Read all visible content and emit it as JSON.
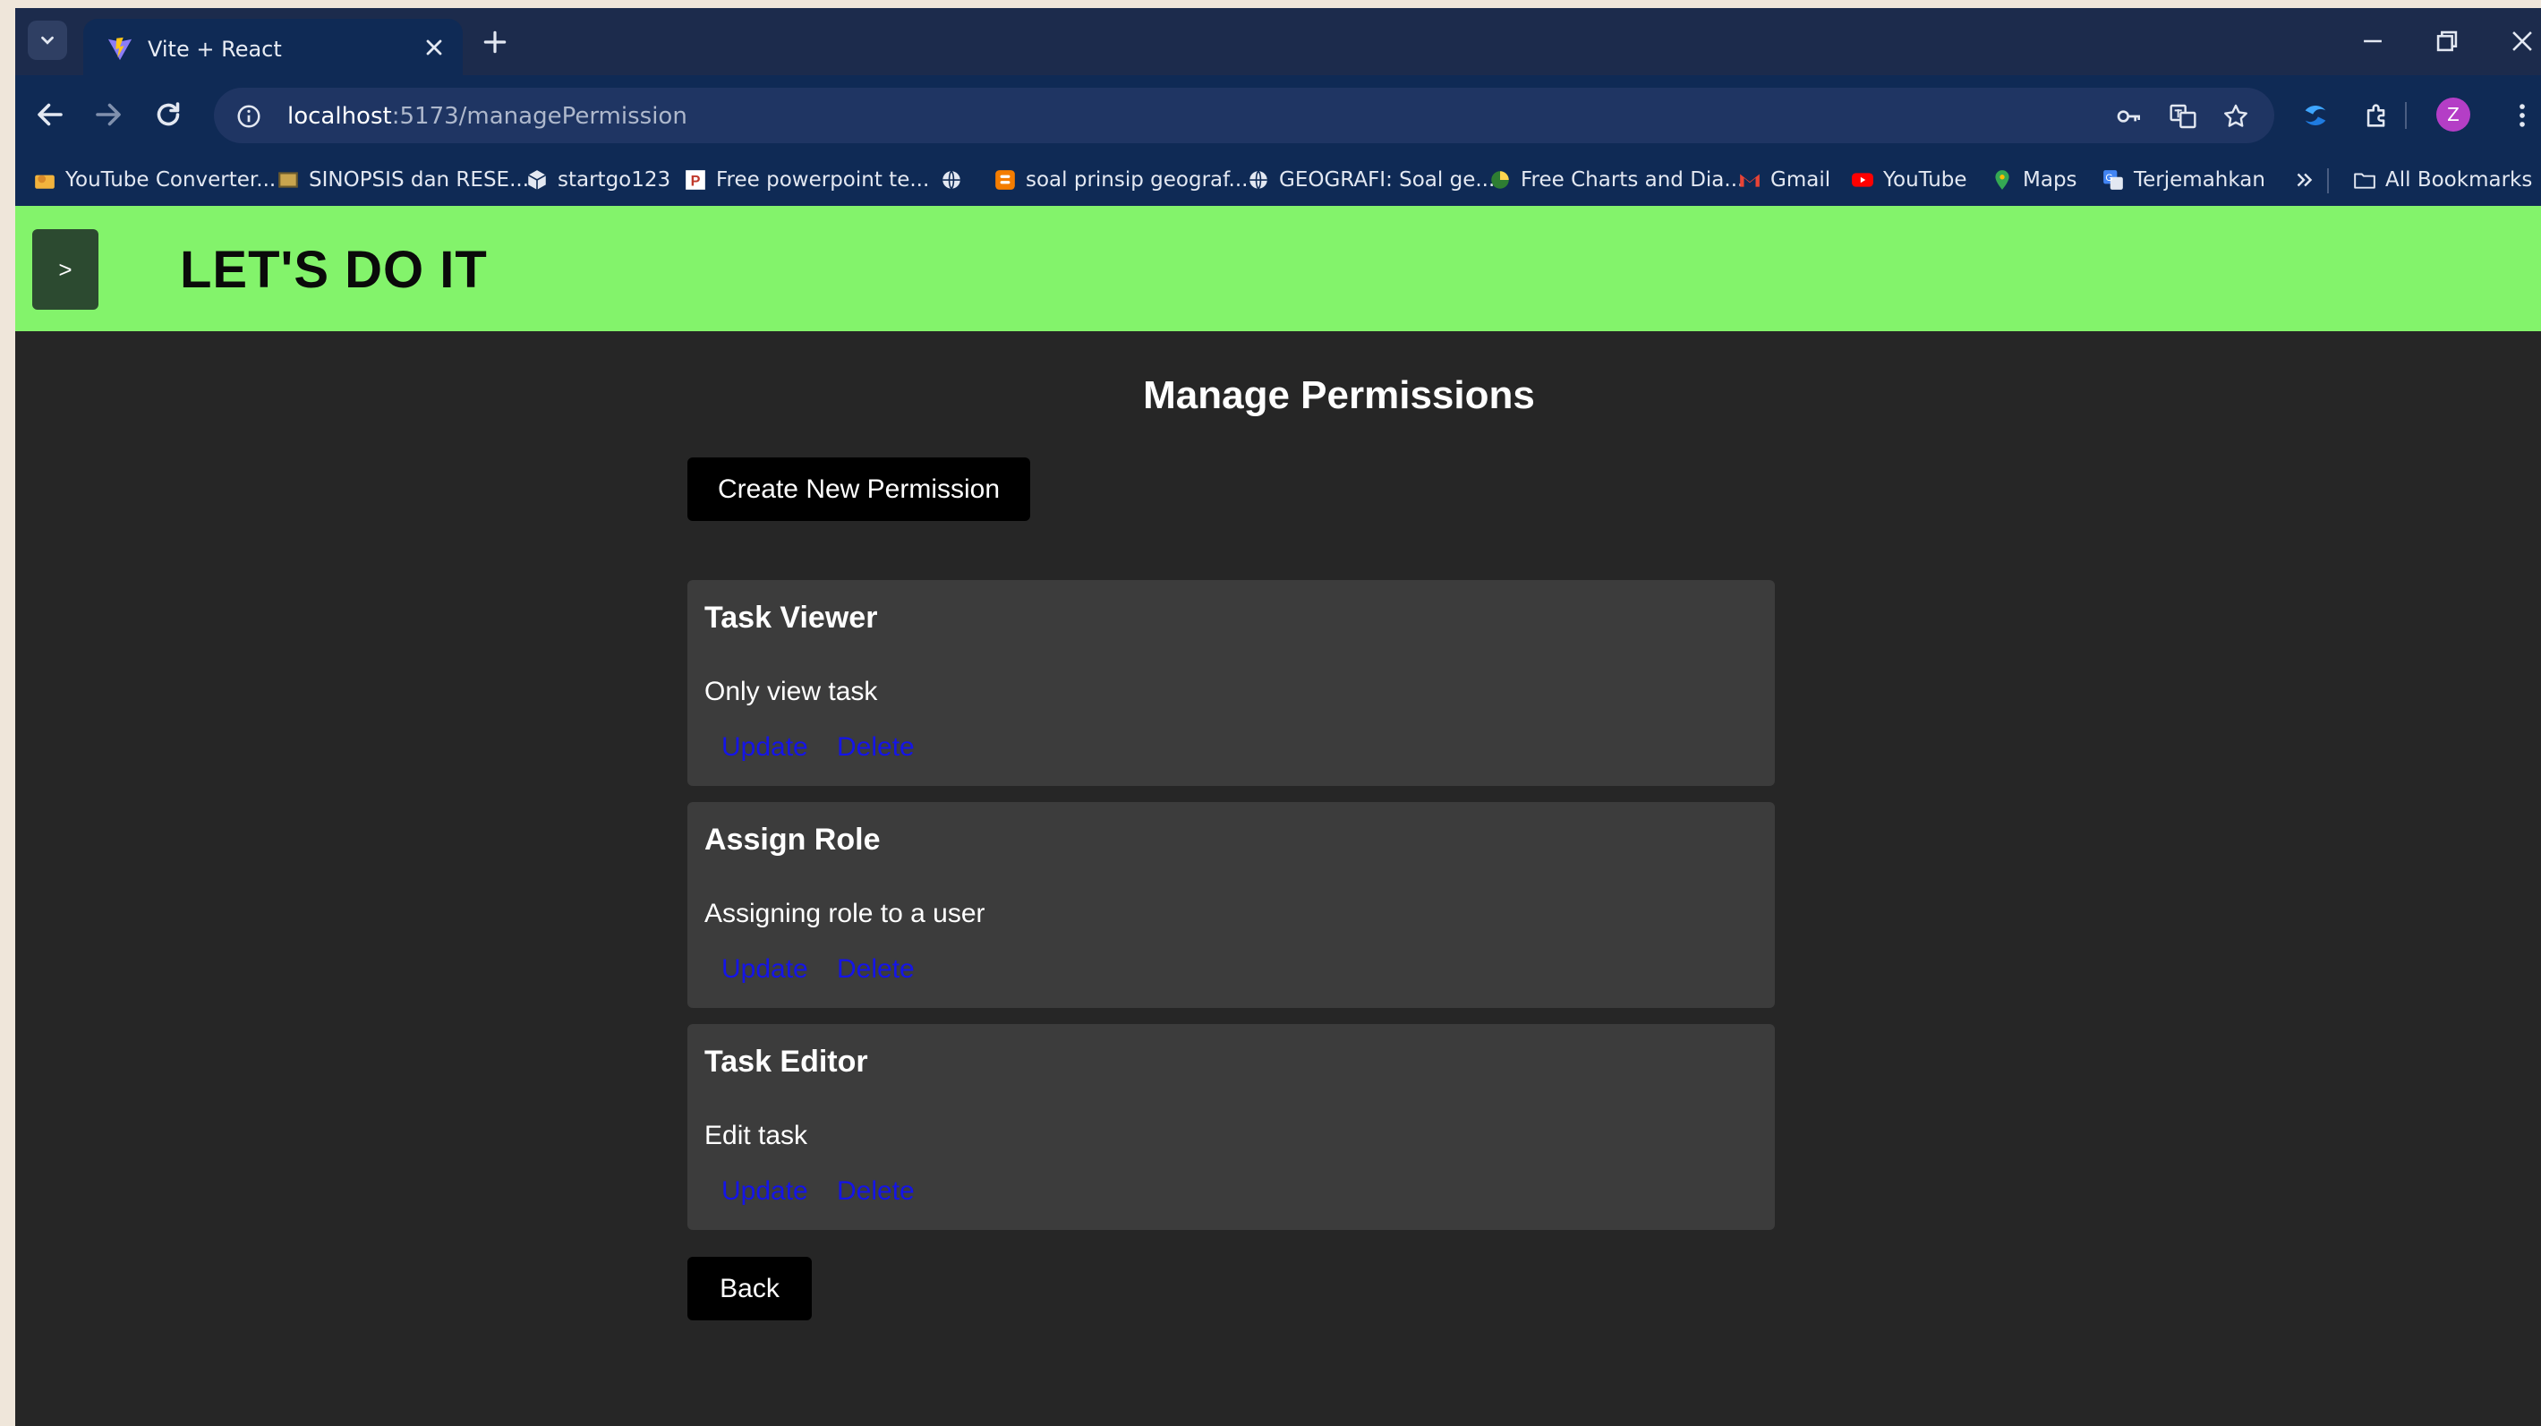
{
  "browser": {
    "tab_title": "Vite + React",
    "url_host": "localhost",
    "url_path": ":5173/managePermission",
    "avatar_letter": "Z",
    "bookmarks": [
      {
        "label": "YouTube Converter...",
        "icon": "folder-cat-icon"
      },
      {
        "label": "SINOPSIS dan RESE...",
        "icon": "photo-icon"
      },
      {
        "label": "startgo123",
        "icon": "cube-icon"
      },
      {
        "label": "Free powerpoint te...",
        "icon": "p-icon"
      },
      {
        "label": "",
        "icon": "globe-icon"
      },
      {
        "label": "soal prinsip geograf...",
        "icon": "blogger-icon"
      },
      {
        "label": "GEOGRAFI: Soal ge...",
        "icon": "globe-icon"
      },
      {
        "label": "Free Charts and Dia...",
        "icon": "chart-icon"
      },
      {
        "label": "Gmail",
        "icon": "gmail-icon"
      },
      {
        "label": "YouTube",
        "icon": "youtube-icon"
      },
      {
        "label": "Maps",
        "icon": "maps-icon"
      },
      {
        "label": "Terjemahkan",
        "icon": "translate-icon"
      }
    ],
    "all_bookmarks_label": "All Bookmarks"
  },
  "app": {
    "menu_toggle_label": ">",
    "brand": "LET'S DO IT",
    "page_title": "Manage Permissions",
    "create_button": "Create New Permission",
    "back_button": "Back",
    "permissions": [
      {
        "name": "Task Viewer",
        "description": "Only view task",
        "update": "Update",
        "delete": "Delete"
      },
      {
        "name": "Assign Role",
        "description": "Assigning role to a user",
        "update": "Update",
        "delete": "Delete"
      },
      {
        "name": "Task Editor",
        "description": "Edit task",
        "update": "Update",
        "delete": "Delete"
      }
    ]
  },
  "colors": {
    "header_green": "#83f36b",
    "page_bg": "#262626",
    "card_bg": "#3c3c3c",
    "link_blue": "#1414e8",
    "browser_chrome": "#0f2a55"
  }
}
